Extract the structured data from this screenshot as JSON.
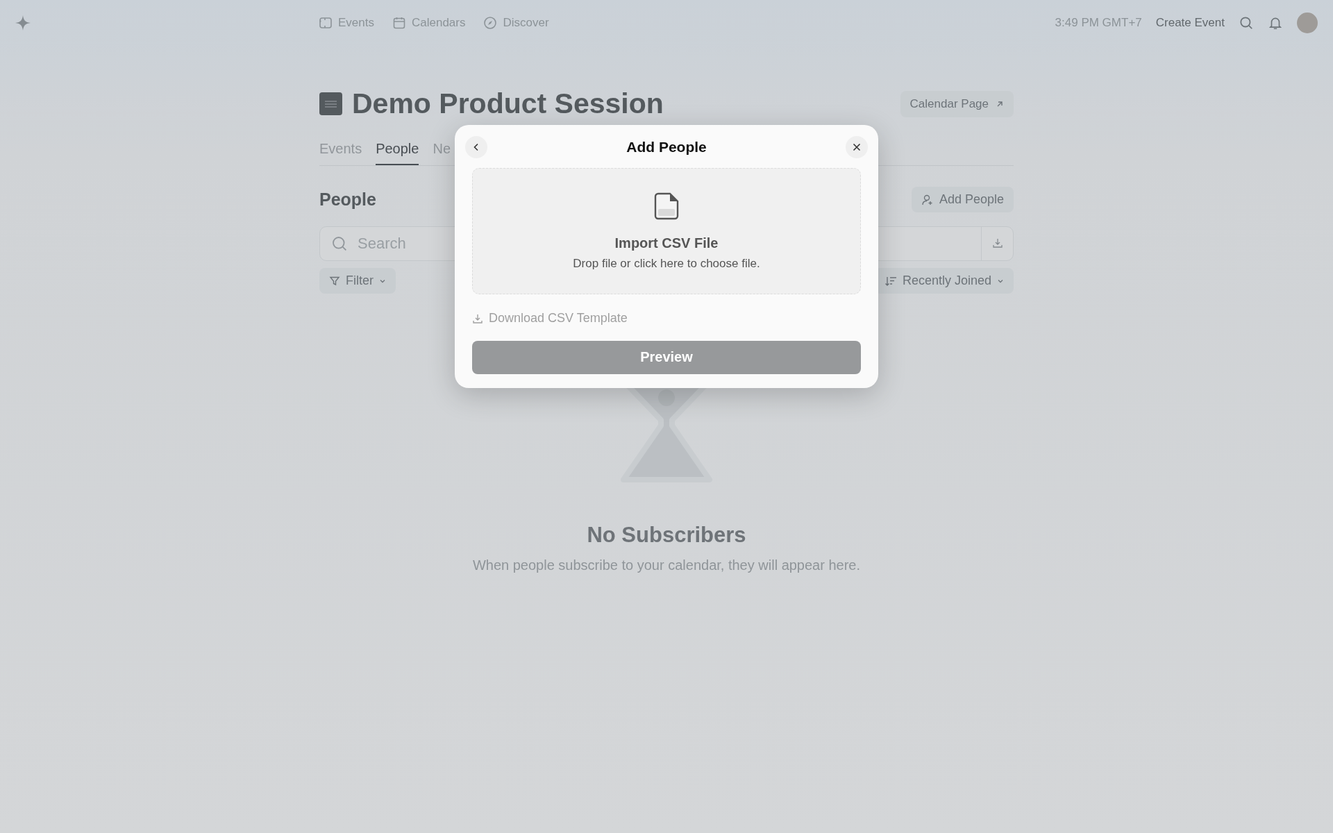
{
  "nav": {
    "links": [
      {
        "label": "Events"
      },
      {
        "label": "Calendars"
      },
      {
        "label": "Discover"
      }
    ],
    "time": "3:49 PM GMT+7",
    "create": "Create Event"
  },
  "calendar": {
    "title": "Demo Product Session",
    "page_link": "Calendar Page"
  },
  "tabs": [
    {
      "label": "Events",
      "selected": false
    },
    {
      "label": "People",
      "selected": true
    },
    {
      "label": "Ne",
      "selected": false
    }
  ],
  "people": {
    "heading": "People",
    "add": "Add People",
    "search": {
      "placeholder": "Search"
    },
    "filter": "Filter",
    "sort": "Recently Joined"
  },
  "empty": {
    "title": "No Subscribers",
    "text": "When people subscribe to your calendar, they will appear here."
  },
  "modal": {
    "title": "Add People",
    "drop_title": "Import CSV File",
    "drop_text": "Drop file or click here to choose file.",
    "template": "Download CSV Template",
    "button": "Preview"
  }
}
